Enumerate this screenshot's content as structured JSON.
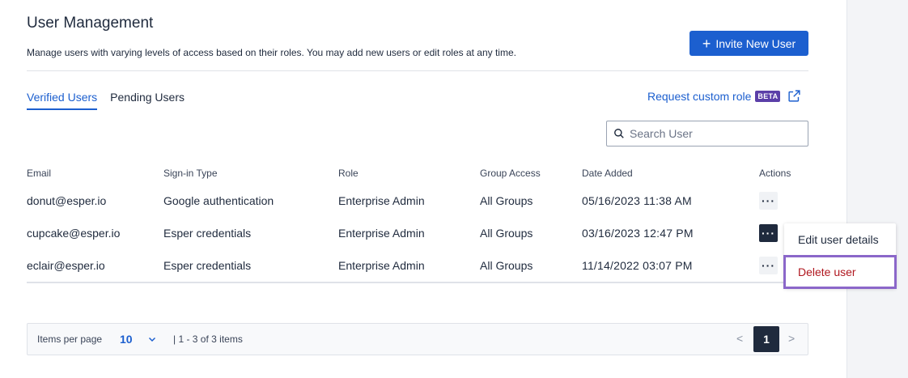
{
  "header": {
    "title": "User Management",
    "subtitle": "Manage users with varying levels of access based on their roles. You may add new users or edit roles at any time.",
    "invite_label": "Invite New User"
  },
  "tabs": [
    {
      "label": "Verified Users",
      "active": true
    },
    {
      "label": "Pending Users",
      "active": false
    }
  ],
  "request_role": {
    "label": "Request custom role",
    "badge": "BETA"
  },
  "search": {
    "placeholder": "Search User",
    "value": ""
  },
  "table": {
    "columns": [
      "Email",
      "Sign-in Type",
      "Role",
      "Group Access",
      "Date Added",
      "Actions"
    ],
    "rows": [
      {
        "email": "donut@esper.io",
        "signin": "Google authentication",
        "role": "Enterprise Admin",
        "group": "All Groups",
        "date": "05/16/2023 11:38 AM",
        "action_label": "···"
      },
      {
        "email": "cupcake@esper.io",
        "signin": "Esper credentials",
        "role": "Enterprise Admin",
        "group": "All Groups",
        "date": "03/16/2023 12:47 PM",
        "action_label": "···"
      },
      {
        "email": "eclair@esper.io",
        "signin": "Esper credentials",
        "role": "Enterprise Admin",
        "group": "All Groups",
        "date": "11/14/2022 03:07 PM",
        "action_label": "···"
      }
    ]
  },
  "actions_menu": {
    "items": [
      "Edit user details",
      "Delete user"
    ]
  },
  "pagination": {
    "items_per_page_label": "Items per page",
    "items_per_page": "10",
    "range": "| 1 - 3 of 3 items",
    "current_page": "1",
    "prev": "<",
    "next": ">"
  },
  "colors": {
    "primary": "#1c5fcf",
    "dark": "#1f2a3d",
    "beta": "#5b3fa8",
    "danger": "#b0171f",
    "highlight": "#8b67c9"
  }
}
